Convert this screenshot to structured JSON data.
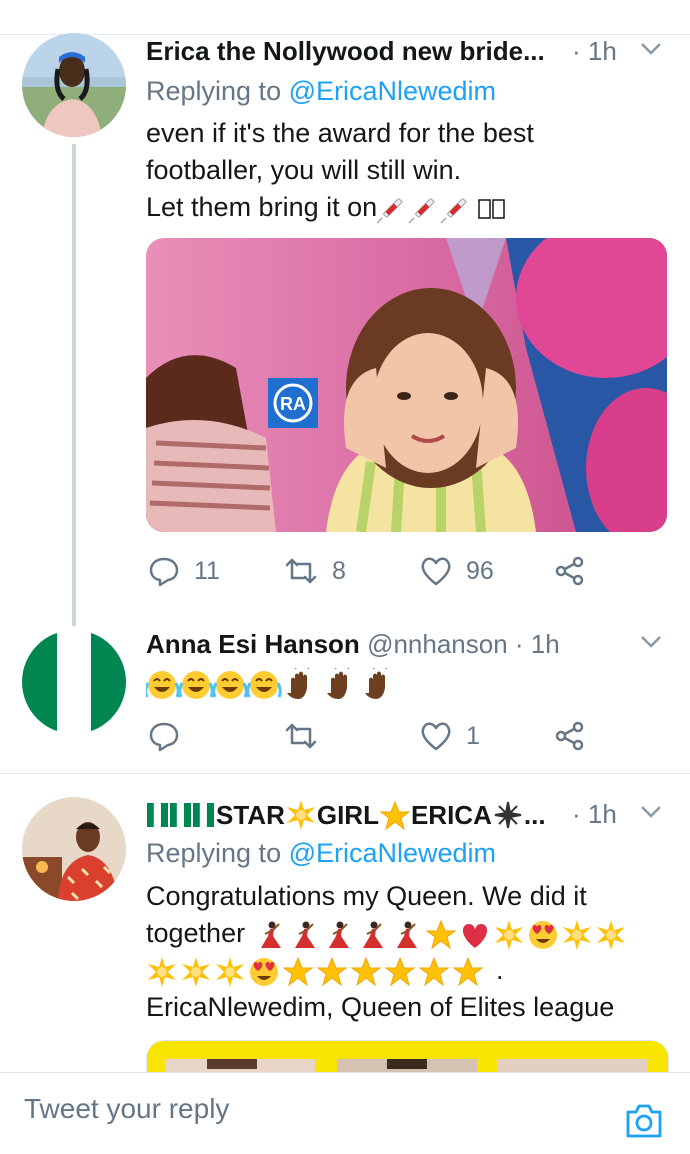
{
  "tweets": [
    {
      "display_name": "Erica the Nollywood new bride...",
      "time": "· 1h",
      "replying_prefix": "Replying to ",
      "replying_handle": "@EricaNlewedim",
      "lines": [
        "even if it's the award for the best",
        "footballer, you will still win.",
        "Let them bring it on"
      ],
      "media_badge": "RA",
      "replies": "11",
      "retweets": "8",
      "likes": "96"
    },
    {
      "display_name": "Anna Esi Hanson",
      "handle": "@nnhanson",
      "time": "· 1h",
      "likes": "1"
    },
    {
      "display_name_parts": [
        "STAR",
        "GIRL ",
        "ERICA",
        "..."
      ],
      "time": "· 1h",
      "replying_prefix": "Replying to ",
      "replying_handle": "@EricaNlewedim",
      "lines": [
        "Congratulations my Queen. We did it",
        "together",
        ".",
        "EricaNlewedim, Queen of Elites league"
      ]
    }
  ],
  "compose": {
    "placeholder": "Tweet your reply",
    "camera_icon": "camera-icon"
  },
  "colors": {
    "accent": "#1da1f2",
    "muted": "#657786",
    "nigeria_green": "#008751"
  }
}
